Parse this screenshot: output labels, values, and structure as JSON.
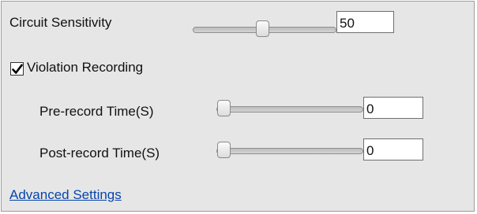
{
  "circuit_sensitivity": {
    "label": "Circuit Sensitivity",
    "value": "50",
    "min": 0,
    "max": 100
  },
  "violation_recording": {
    "label": "Violation Recording",
    "checked": true
  },
  "pre_record": {
    "label": "Pre-record Time(S)",
    "value": "0"
  },
  "post_record": {
    "label": "Post-record Time(S)",
    "value": "0"
  },
  "advanced_link": {
    "label": "Advanced Settings"
  },
  "colors": {
    "panel_bg": "#e6e6e6",
    "link": "#0645ad"
  },
  "icons": {
    "checkbox_mark": "checkmark-icon"
  }
}
